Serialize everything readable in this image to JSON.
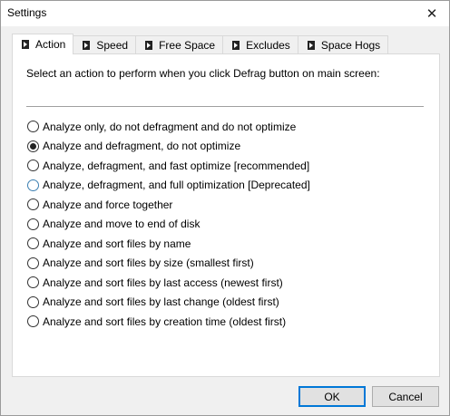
{
  "window": {
    "title": "Settings",
    "close_glyph": "✕"
  },
  "tabs": [
    {
      "label": "Action",
      "icon": "play-icon",
      "active": true
    },
    {
      "label": "Speed",
      "icon": "play-icon",
      "active": false
    },
    {
      "label": "Free Space",
      "icon": "play-icon",
      "active": false
    },
    {
      "label": "Excludes",
      "icon": "play-icon",
      "active": false
    },
    {
      "label": "Space Hogs",
      "icon": "play-icon",
      "active": false
    }
  ],
  "panel": {
    "instruction": "Select an action to perform when you click Defrag button on main screen:",
    "options": [
      {
        "label": "Analyze only, do not defragment and do not optimize",
        "selected": false
      },
      {
        "label": "Analyze and defragment, do not optimize",
        "selected": true
      },
      {
        "label": "Analyze, defragment, and fast optimize [recommended]",
        "selected": false
      },
      {
        "label": "Analyze, defragment, and full optimization [Deprecated]",
        "selected": false
      },
      {
        "label": "Analyze and force together",
        "selected": false
      },
      {
        "label": "Analyze and move to end of disk",
        "selected": false
      },
      {
        "label": "Analyze and sort files by name",
        "selected": false
      },
      {
        "label": "Analyze and sort files by size (smallest first)",
        "selected": false
      },
      {
        "label": "Analyze and sort files by last access (newest first)",
        "selected": false
      },
      {
        "label": "Analyze and sort files by last change (oldest first)",
        "selected": false
      },
      {
        "label": "Analyze and sort files by creation time (oldest first)",
        "selected": false
      }
    ]
  },
  "buttons": {
    "ok": "OK",
    "cancel": "Cancel"
  },
  "colors": {
    "accent": "#0078d7",
    "panel_bg": "#ffffff",
    "window_bg": "#f0f0f0"
  }
}
